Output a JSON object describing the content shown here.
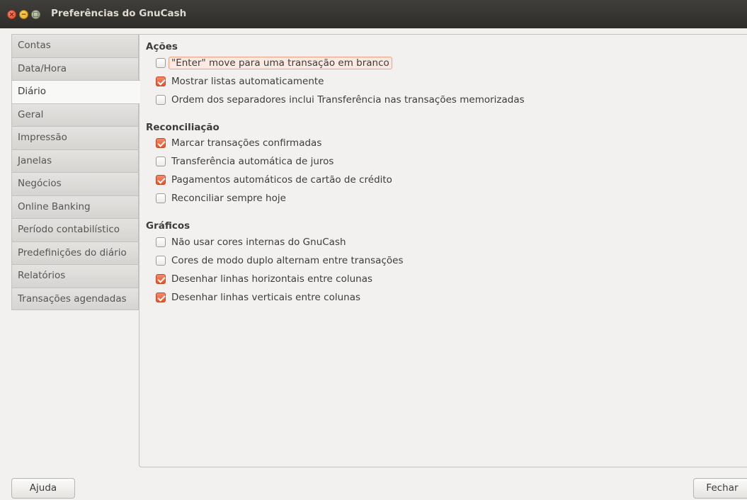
{
  "window": {
    "title": "Preferências do GnuCash",
    "controls": [
      "close",
      "minimize",
      "maximize"
    ]
  },
  "sidebar": {
    "tabs": [
      {
        "label": "Contas",
        "active": false
      },
      {
        "label": "Data/Hora",
        "active": false
      },
      {
        "label": "Diário",
        "active": true
      },
      {
        "label": "Geral",
        "active": false
      },
      {
        "label": "Impressão",
        "active": false
      },
      {
        "label": "Janelas",
        "active": false
      },
      {
        "label": "Negócios",
        "active": false
      },
      {
        "label": "Online Banking",
        "active": false
      },
      {
        "label": "Período contabilístico",
        "active": false
      },
      {
        "label": "Predefinições do diário",
        "active": false
      },
      {
        "label": "Relatórios",
        "active": false
      },
      {
        "label": "Transações agendadas",
        "active": false
      }
    ]
  },
  "sections": {
    "acoes": {
      "title": "Ações",
      "options": [
        {
          "label": "\"Enter\" move para uma transação em branco",
          "checked": false,
          "focused": true
        },
        {
          "label": "Mostrar listas automaticamente",
          "checked": true
        },
        {
          "label": "Ordem dos separadores inclui Transferência nas transações memorizadas",
          "checked": false
        }
      ]
    },
    "reconciliacao": {
      "title": "Reconciliação",
      "options": [
        {
          "label": "Marcar transações confirmadas",
          "checked": true
        },
        {
          "label": "Transferência automática de juros",
          "checked": false
        },
        {
          "label": "Pagamentos automáticos de cartão de crédito",
          "checked": true
        },
        {
          "label": "Reconciliar sempre hoje",
          "checked": false
        }
      ]
    },
    "graficos": {
      "title": "Gráficos",
      "options": [
        {
          "label": "Não usar cores internas do GnuCash",
          "checked": false
        },
        {
          "label": "Cores de modo duplo alternam entre transações",
          "checked": false
        },
        {
          "label": "Desenhar linhas horizontais entre colunas",
          "checked": true
        },
        {
          "label": "Desenhar linhas verticais entre colunas",
          "checked": true
        }
      ]
    }
  },
  "buttons": {
    "help": "Ajuda",
    "close": "Fechar"
  },
  "colors": {
    "accent": "#e2562f",
    "titlebar": "#3a3935"
  }
}
